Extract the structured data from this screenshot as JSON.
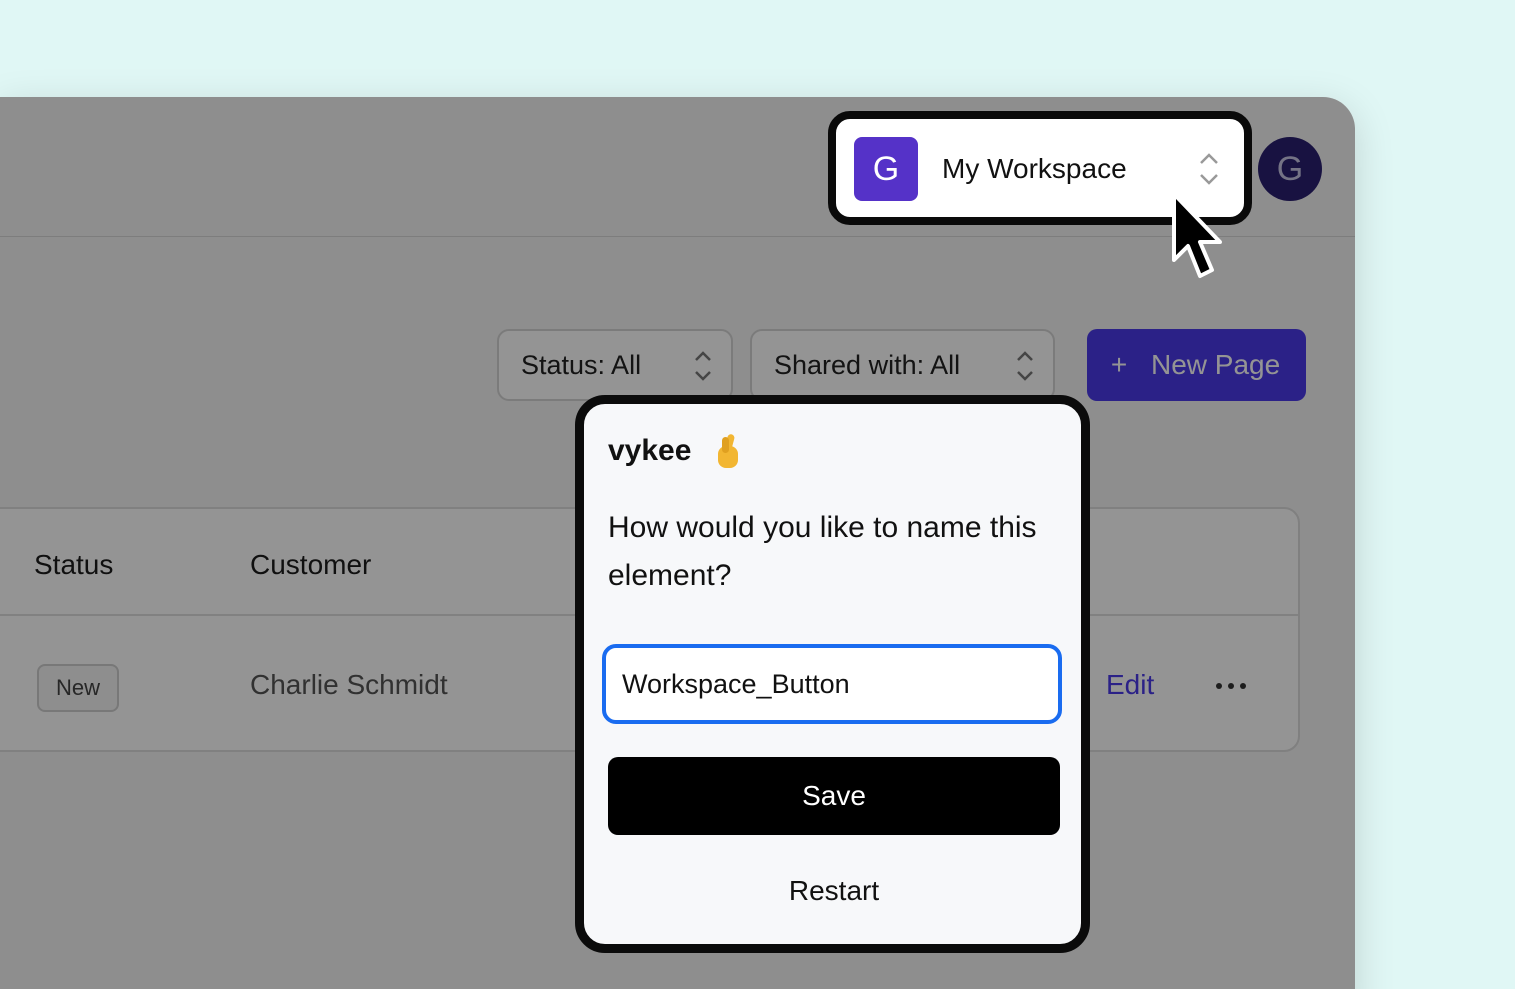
{
  "workspace": {
    "avatar_letter": "G",
    "name": "My Workspace"
  },
  "user": {
    "avatar_letter": "G"
  },
  "filters": {
    "status_label": "Status: All",
    "shared_label": "Shared with: All"
  },
  "new_page": {
    "plus": "+",
    "label": "New Page"
  },
  "table": {
    "columns": [
      "Status",
      "Customer"
    ],
    "rows": [
      {
        "status": "New",
        "customer": "Charlie Schmidt",
        "action": "Edit"
      }
    ]
  },
  "dialog": {
    "brand": "vykee",
    "question": "How would you like to name this element?",
    "input_value": "Workspace_Button",
    "save_label": "Save",
    "restart_label": "Restart"
  },
  "colors": {
    "background": "#e0f7f5",
    "accent": "#4a3ae8",
    "workspace_avatar": "#5532c8",
    "input_focus": "#1a6cf0"
  },
  "icons": {
    "chevron": "chevron-up-down-icon",
    "more": "more-horizontal-icon",
    "cursor": "mouse-cursor-icon",
    "emoji": "crossed-fingers-icon"
  }
}
